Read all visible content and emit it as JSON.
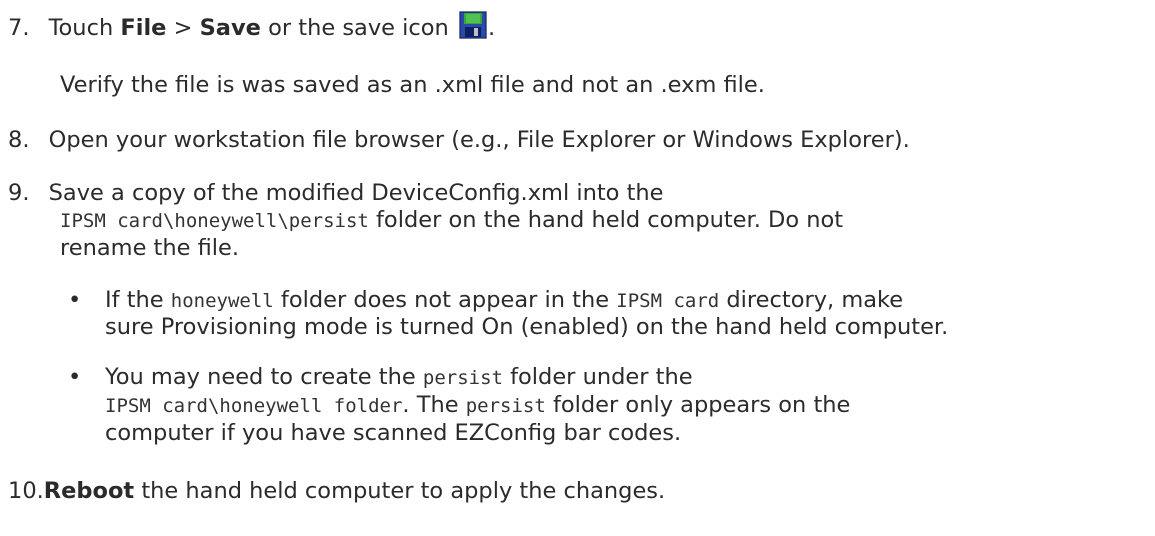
{
  "steps": {
    "s7": {
      "num": "7.",
      "t1": "Touch ",
      "b1": "File",
      "t2": " > ",
      "b2": "Save",
      "t3": " or the save icon ",
      "t4": ".",
      "icon": "floppy-disk-save-icon",
      "sub": "Verify the file is was saved as an .xml file and not an .exm file."
    },
    "s8": {
      "num": "8.",
      "text": "Open your workstation file browser (e.g., File Explorer or Windows Explorer)."
    },
    "s9": {
      "num": "9.",
      "l1": "Save a copy of the modified DeviceConfig.xml into the",
      "l2code": "IPSM card\\honeywell\\persist",
      "l2text": " folder on the hand held computer. Do not",
      "l3": "rename the file.",
      "bullet_char": "•",
      "b1": {
        "t1": "If the ",
        "c1": "honeywell",
        "t2": " folder does not appear in the ",
        "c2": "IPSM card",
        "t3": " directory, make",
        "l2": "sure Provisioning mode is turned On (enabled) on the hand held computer."
      },
      "b2": {
        "t1": "You may need to create the ",
        "c1": "persist",
        "t2": " folder under the",
        "l2code": "IPSM card\\honeywell folder",
        "l2t1": ". The ",
        "l2c2": "persist",
        "l2t2": " folder only appears on the",
        "l3": "computer if you have scanned EZConfig bar codes."
      }
    },
    "s10": {
      "num": "10.",
      "bold": "Reboot",
      "text": " the hand held computer to apply the changes."
    }
  },
  "colors": {
    "text": "#2b2b2b",
    "icon_blue": "#1f3fa0",
    "icon_green": "#2e8b2e"
  }
}
